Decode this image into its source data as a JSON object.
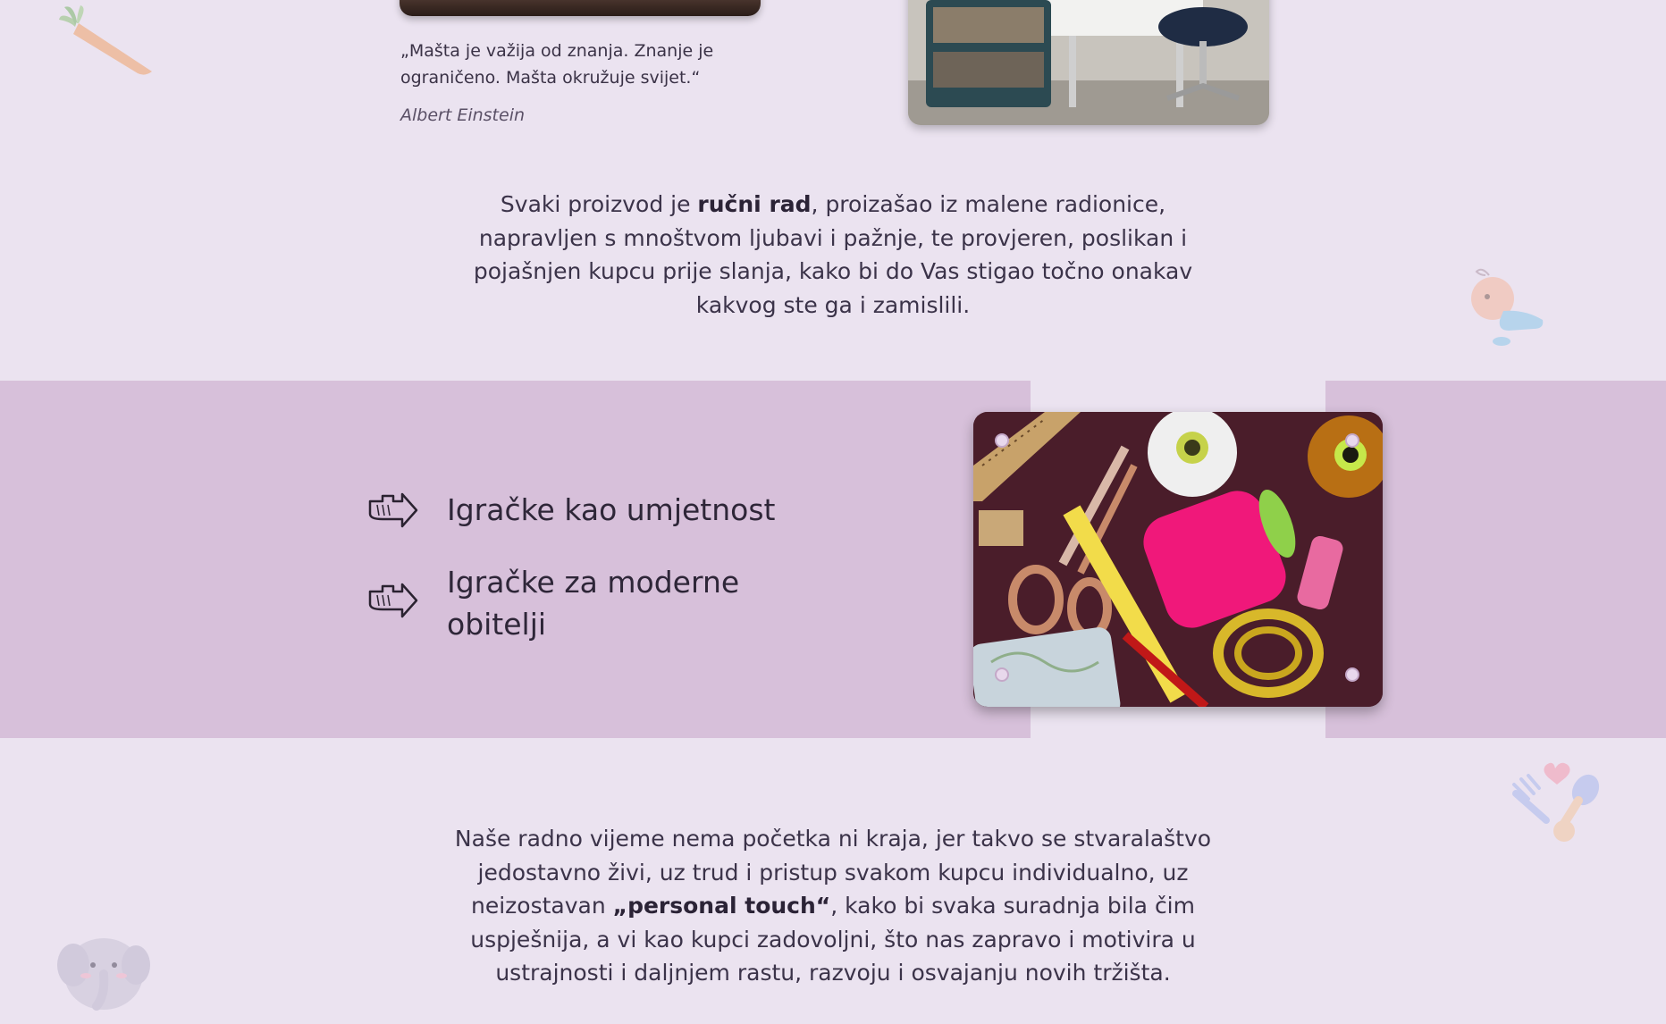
{
  "quote": {
    "text": "„Mašta je važija od znanja. Znanje je ograničeno. Mašta okružuje svijet.“",
    "author": "Albert Einstein"
  },
  "intro": {
    "part1": "Svaki proizvod je ",
    "bold": "ručni rad",
    "part2": ", proizašao iz malene radionice, napravljen s mnoštvom ljubavi i pažnje, te provjeren, poslikan i pojašnjen kupcu prije slanja, kako bi do Vas stigao točno onakav kakvog ste ga i zamislili."
  },
  "features": [
    {
      "label": "Igračke kao umjetnost",
      "icon": "pointing-hand-icon"
    },
    {
      "label": "Igračke za moderne obitelji",
      "icon": "pointing-hand-icon"
    }
  ],
  "outro": {
    "part1": "Naše radno vijeme nema početka ni kraja, jer takvo se stvaralaštvo jedostavno živi, uz trud i pristup svakom kupcu individualno, uz neizostavan ",
    "bold": "„personal touch“",
    "part2": ", kako bi svaka suradnja bila čim uspješnija, a vi kao kupci zadovoljni, što nas zapravo i motivira u ustrajnosti i daljnjem rastu, razvoju i osvajanju novih tržišta."
  },
  "colors": {
    "background": "#ebe3f0",
    "band": "#d7c0da",
    "text": "#3b3349"
  },
  "decorations": [
    "carrot-icon",
    "crawling-baby-icon",
    "fork-spoon-heart-icon",
    "elephant-icon"
  ]
}
